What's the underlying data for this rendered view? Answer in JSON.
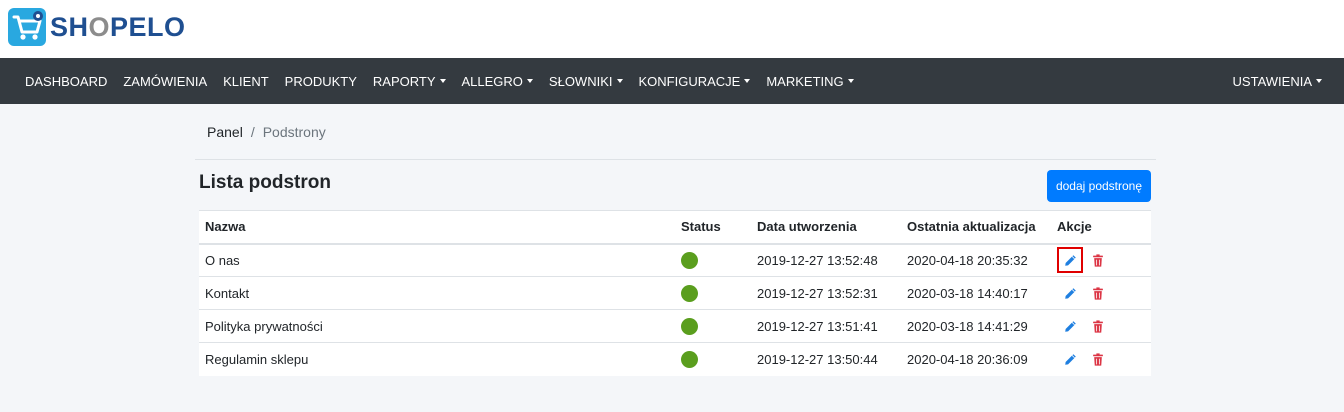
{
  "brand": {
    "name_prefix": "SH",
    "name_o": "O",
    "name_suffix": "PELO"
  },
  "nav": {
    "items": [
      {
        "label": "DASHBOARD",
        "dropdown": false
      },
      {
        "label": "ZAMÓWIENIA",
        "dropdown": false
      },
      {
        "label": "KLIENT",
        "dropdown": false
      },
      {
        "label": "PRODUKTY",
        "dropdown": false
      },
      {
        "label": "RAPORTY",
        "dropdown": true
      },
      {
        "label": "ALLEGRO",
        "dropdown": true
      },
      {
        "label": "SŁOWNIKI",
        "dropdown": true
      },
      {
        "label": "KONFIGURACJE",
        "dropdown": true
      },
      {
        "label": "MARKETING",
        "dropdown": true
      }
    ],
    "settings": {
      "label": "USTAWIENIA",
      "dropdown": true
    }
  },
  "breadcrumb": {
    "root": "Panel",
    "separator": "/",
    "current": "Podstrony"
  },
  "page": {
    "title": "Lista podstron",
    "add_button": "dodaj podstronę"
  },
  "table": {
    "headers": {
      "name": "Nazwa",
      "status": "Status",
      "created": "Data utworzenia",
      "updated": "Ostatnia aktualizacja",
      "actions": "Akcje"
    },
    "rows": [
      {
        "name": "O nas",
        "status": "active",
        "created": "2019-12-27 13:52:48",
        "updated": "2020-04-18 20:35:32"
      },
      {
        "name": "Kontakt",
        "status": "active",
        "created": "2019-12-27 13:52:31",
        "updated": "2020-03-18 14:40:17"
      },
      {
        "name": "Polityka prywatności",
        "status": "active",
        "created": "2019-12-27 13:51:41",
        "updated": "2020-03-18 14:41:29"
      },
      {
        "name": "Regulamin sklepu",
        "status": "active",
        "created": "2019-12-27 13:50:44",
        "updated": "2020-04-18 20:36:09"
      }
    ]
  },
  "colors": {
    "primary": "#007bff",
    "navbar": "#343a40",
    "status_active": "#5a9e1e",
    "danger": "#dc3545",
    "highlight": "#e00000"
  },
  "icons": {
    "edit": "pencil-icon",
    "delete": "trash-icon",
    "logo": "cart-icon"
  }
}
